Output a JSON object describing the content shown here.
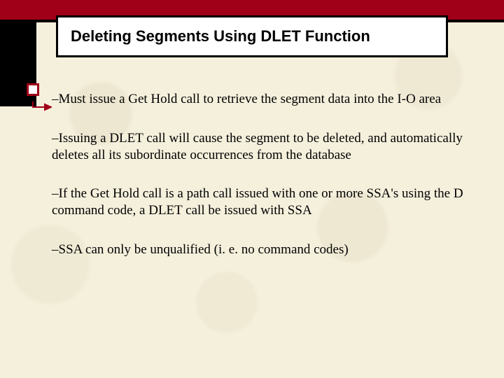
{
  "colors": {
    "accent_red": "#a00018",
    "background": "#f5f0dc",
    "black": "#000000",
    "white": "#ffffff"
  },
  "title": "Deleting Segments Using DLET Function",
  "bullets": [
    "–Must issue a Get Hold call to retrieve the segment data into the I-O area",
    "–Issuing a DLET call will cause the segment to be deleted, and automatically deletes all its subordinate occurrences from the database",
    "–If the Get Hold call is a path call issued with one or more SSA's using the D command code, a DLET call be issued with SSA",
    "–SSA can only be unqualified (i. e. no command codes)"
  ]
}
